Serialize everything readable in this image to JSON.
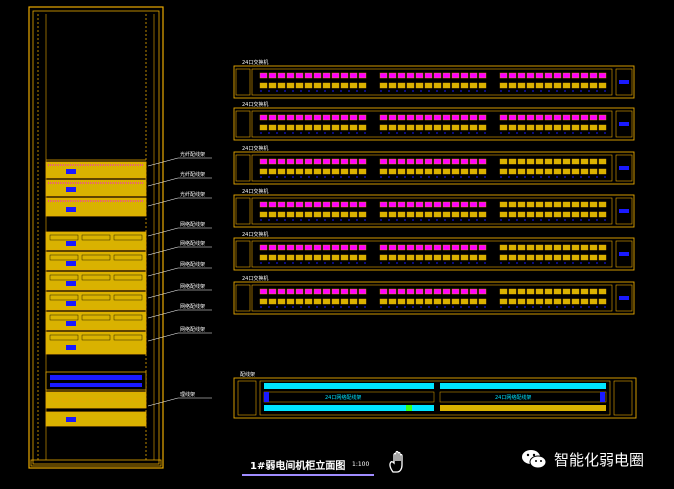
{
  "colors": {
    "frame": "#e8a800",
    "port_fill": "#d9b200",
    "magenta": "#ff00ff",
    "blue": "#1a1aff",
    "cyan": "#00e5ff",
    "green": "#39ff14",
    "white": "#ffffff",
    "accent_line": "#a08cff"
  },
  "cabinet": {
    "callouts": [
      "光纤配线架",
      "光纤配线架",
      "光纤配线架",
      "网络配线架",
      "网络配线架",
      "网络配线架",
      "网络配线架",
      "网络配线架",
      "网络配线架",
      "理线架"
    ]
  },
  "switch_panels": {
    "count": 6,
    "ports_per_group": 12,
    "groups": 3,
    "labels": [
      "24口交换机",
      "24口交换机",
      "24口交换机",
      "24口交换机",
      "24口交换机",
      "24口交换机"
    ]
  },
  "patch_panel": {
    "label": "配线架",
    "left_text": "24口网络配线架",
    "right_text": "24口网络配线架"
  },
  "title": {
    "main": "1#弱电间机柜立面图",
    "scale": "1:100"
  },
  "watermark": {
    "text": "智能化弱电圈",
    "icon": "wechat-icon"
  },
  "icons": {
    "hand": "hand-icon"
  }
}
